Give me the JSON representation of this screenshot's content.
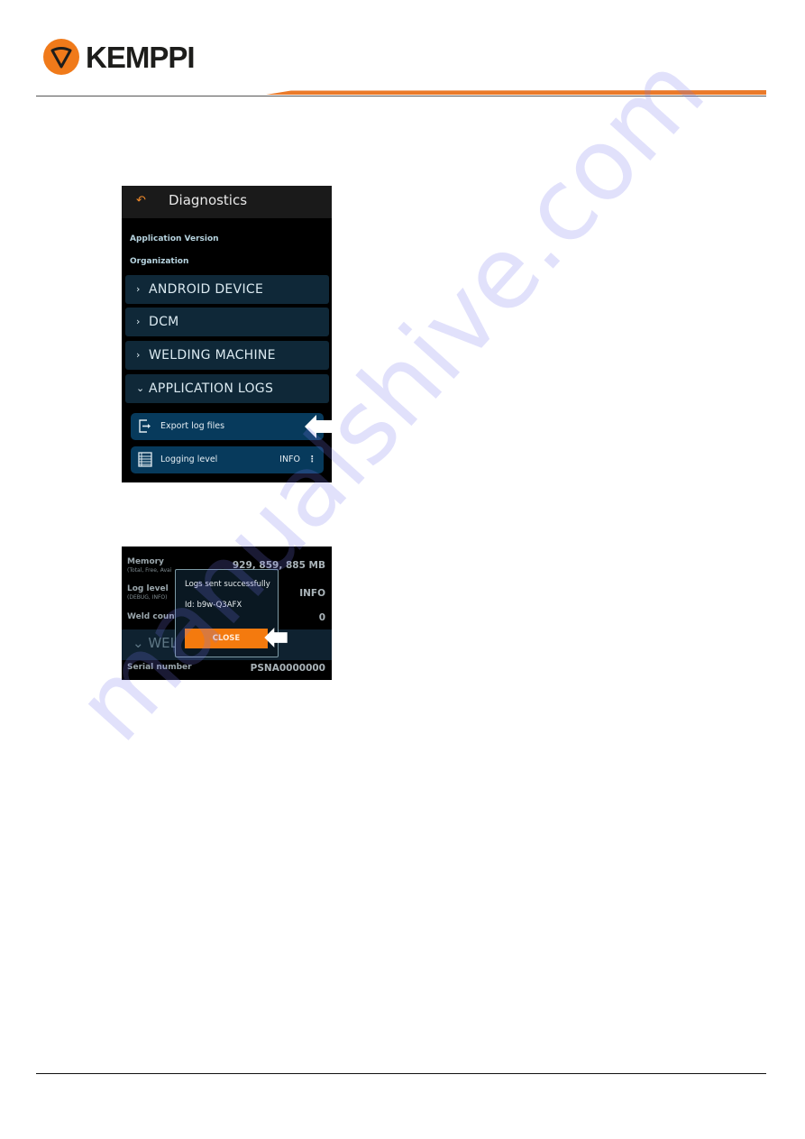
{
  "header": {
    "brand": "KEMPPI",
    "brand_color": "#f07a1a"
  },
  "screen1": {
    "title": "Diagnostics",
    "back_icon": "back-arrow-icon",
    "info_labels": [
      "Application Version",
      "Organization"
    ],
    "sections": [
      {
        "label": "ANDROID DEVICE",
        "expanded": false
      },
      {
        "label": "DCM",
        "expanded": false
      },
      {
        "label": "WELDING MACHINE",
        "expanded": false
      },
      {
        "label": "APPLICATION LOGS",
        "expanded": true
      }
    ],
    "log_items": [
      {
        "label": "Export log files",
        "icon": "export-icon"
      },
      {
        "label": "Logging level",
        "value": "INFO",
        "icon": "list-icon"
      }
    ],
    "more_glyph": "⋮"
  },
  "screen2": {
    "rows": [
      {
        "label": "Memory",
        "sublabel": "(Total, Free, Avai",
        "value": "929, 859, 885 MB"
      },
      {
        "label": "Log level",
        "sublabel": "(DEBUG, INFO)",
        "value": "INFO"
      },
      {
        "label": "Weld count",
        "value": "0"
      },
      {
        "label": "Serial number",
        "value": "PSNA0000000"
      }
    ],
    "section_partial": "WELD",
    "dialog": {
      "message": "Logs sent successfully",
      "id_text": "Id: b9w-Q3AFX",
      "close_label": "CLOSE"
    }
  },
  "colors": {
    "accent_orange": "#f47a0e",
    "section_bg": "#0f2838",
    "button_bg": "#073a5c"
  },
  "watermark": "manualshive.com"
}
